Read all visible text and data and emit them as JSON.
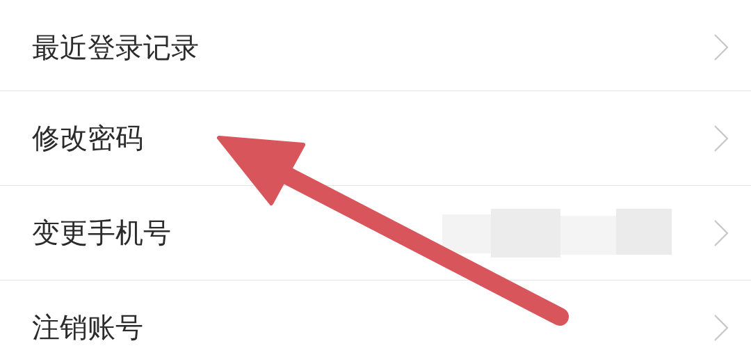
{
  "menu_items": [
    {
      "label": "最近登录记录",
      "redacted": false
    },
    {
      "label": "修改密码",
      "redacted": false
    },
    {
      "label": "变更手机号",
      "redacted": true
    },
    {
      "label": "注销账号",
      "redacted": false
    }
  ],
  "annotation": {
    "kind": "arrow"
  }
}
